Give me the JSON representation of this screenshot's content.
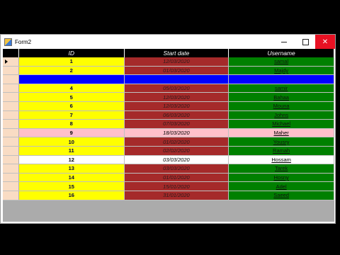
{
  "window": {
    "title": "Form2"
  },
  "icons": {
    "app": "form-app-icon",
    "minimize": "minimize-icon",
    "maximize": "maximize-icon",
    "close": "close-icon"
  },
  "columns": {
    "id": "ID",
    "start_date": "Start date",
    "username": "Username"
  },
  "colors": {
    "id_cell": "#ffff00",
    "date_cell": "#a52a2a",
    "user_cell": "#008000",
    "selected_row": "#0000ff",
    "highlight_row": "#ffc0cb",
    "plain_row": "#ffffff",
    "close_button": "#e81123"
  },
  "rows": [
    {
      "id": "1",
      "start_date": "12/03/2020",
      "username": "samal",
      "style": "default",
      "current": true
    },
    {
      "id": "2",
      "start_date": "01/03/2020",
      "username": "Majdy",
      "style": "default"
    },
    {
      "id": "3",
      "start_date": "",
      "username": "",
      "style": "selected"
    },
    {
      "id": "4",
      "start_date": "05/03/2020",
      "username": "samir",
      "style": "default"
    },
    {
      "id": "5",
      "start_date": "12/03/2020",
      "username": "Bahaa",
      "style": "default"
    },
    {
      "id": "6",
      "start_date": "12/03/2020",
      "username": "Mouna",
      "style": "default"
    },
    {
      "id": "7",
      "start_date": "06/03/2020",
      "username": "Johns",
      "style": "default"
    },
    {
      "id": "8",
      "start_date": "07/03/2020",
      "username": "Michael",
      "style": "default"
    },
    {
      "id": "9",
      "start_date": "18/03/2020",
      "username": "Maher",
      "style": "pink"
    },
    {
      "id": "10",
      "start_date": "01/02/2020",
      "username": "Yousry",
      "style": "default"
    },
    {
      "id": "11",
      "start_date": "02/02/2020",
      "username": "Ramah",
      "style": "default"
    },
    {
      "id": "12",
      "start_date": "03/03/2020",
      "username": "Hossam",
      "style": "white"
    },
    {
      "id": "13",
      "start_date": "03/03/2020",
      "username": "Tarek",
      "style": "default"
    },
    {
      "id": "14",
      "start_date": "01/01/2020",
      "username": "Hosny",
      "style": "default"
    },
    {
      "id": "15",
      "start_date": "15/01/2020",
      "username": "Adel",
      "style": "default"
    },
    {
      "id": "16",
      "start_date": "31/01/2020",
      "username": "Saeed",
      "style": "default"
    }
  ]
}
